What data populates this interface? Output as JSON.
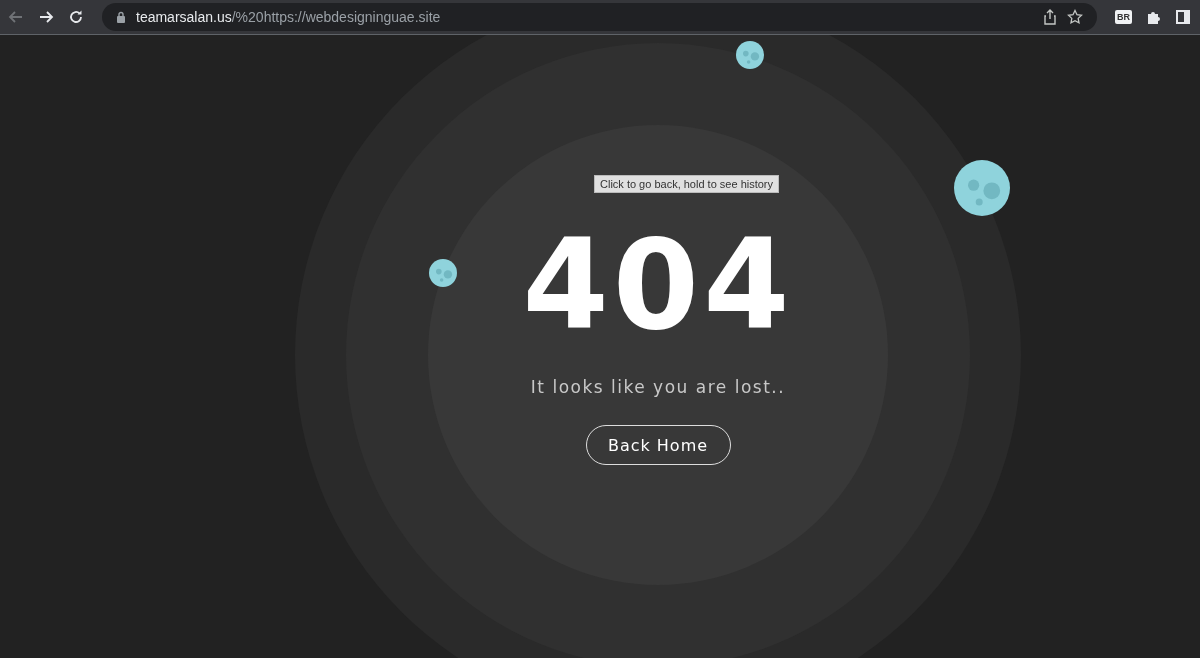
{
  "browser": {
    "back_disabled": true,
    "url_host": "teamarsalan.us",
    "url_path": "/%20https://webdesigninguae.site",
    "extension_label": "BR"
  },
  "tooltip": "Click to go back, hold to see history",
  "error": {
    "code": "404",
    "message": "It looks like you are lost..",
    "button": "Back Home"
  }
}
